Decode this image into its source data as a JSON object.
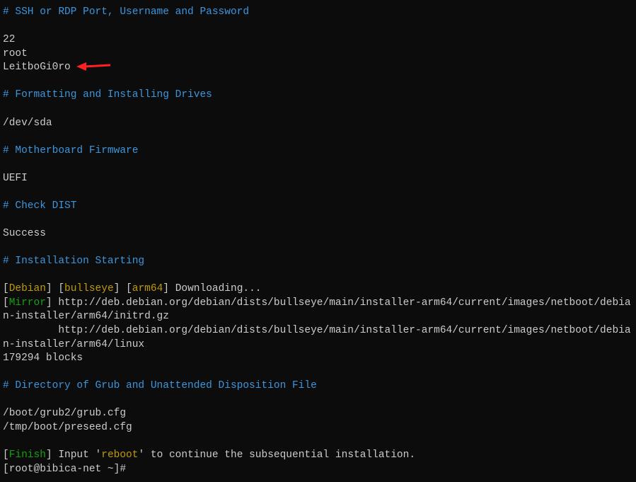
{
  "s1": {
    "header": "# SSH or RDP Port, Username and Password",
    "port": "22",
    "user": "root",
    "pass": "LeitboGi0ro"
  },
  "s2": {
    "header": "# Formatting and Installing Drives",
    "val": "/dev/sda"
  },
  "s3": {
    "header": "# Motherboard Firmware",
    "val": "UEFI"
  },
  "s4": {
    "header": "# Check DIST",
    "val": "Success"
  },
  "s5": {
    "header": "# Installation Starting",
    "lb": "[",
    "rb": "] ",
    "deb": "Debian",
    "bull": "bullseye",
    "arch": "arm64",
    "dl": "Downloading...",
    "mirror": "Mirror",
    "url1": "http://deb.debian.org/debian/dists/bullseye/main/installer-arm64/current/images/netboot/debian-installer/arm64/initrd.gz",
    "pad": "         ",
    "url2": "http://deb.debian.org/debian/dists/bullseye/main/installer-arm64/current/images/netboot/debian-installer/arm64/linux",
    "blocks": "179294 blocks"
  },
  "s6": {
    "header": "# Directory of Grub and Unattended Disposition File",
    "l1": "/boot/grub2/grub.cfg",
    "l2": "/tmp/boot/preseed.cfg"
  },
  "s7": {
    "lb": "[",
    "rb": "] ",
    "fin": "Finish",
    "t1": "Input '",
    "reboot": "reboot",
    "t2": "' to continue the subsequential installation.",
    "prompt_l": "[",
    "prompt_user": "root@bibica-net ~",
    "prompt_r": "]#"
  }
}
